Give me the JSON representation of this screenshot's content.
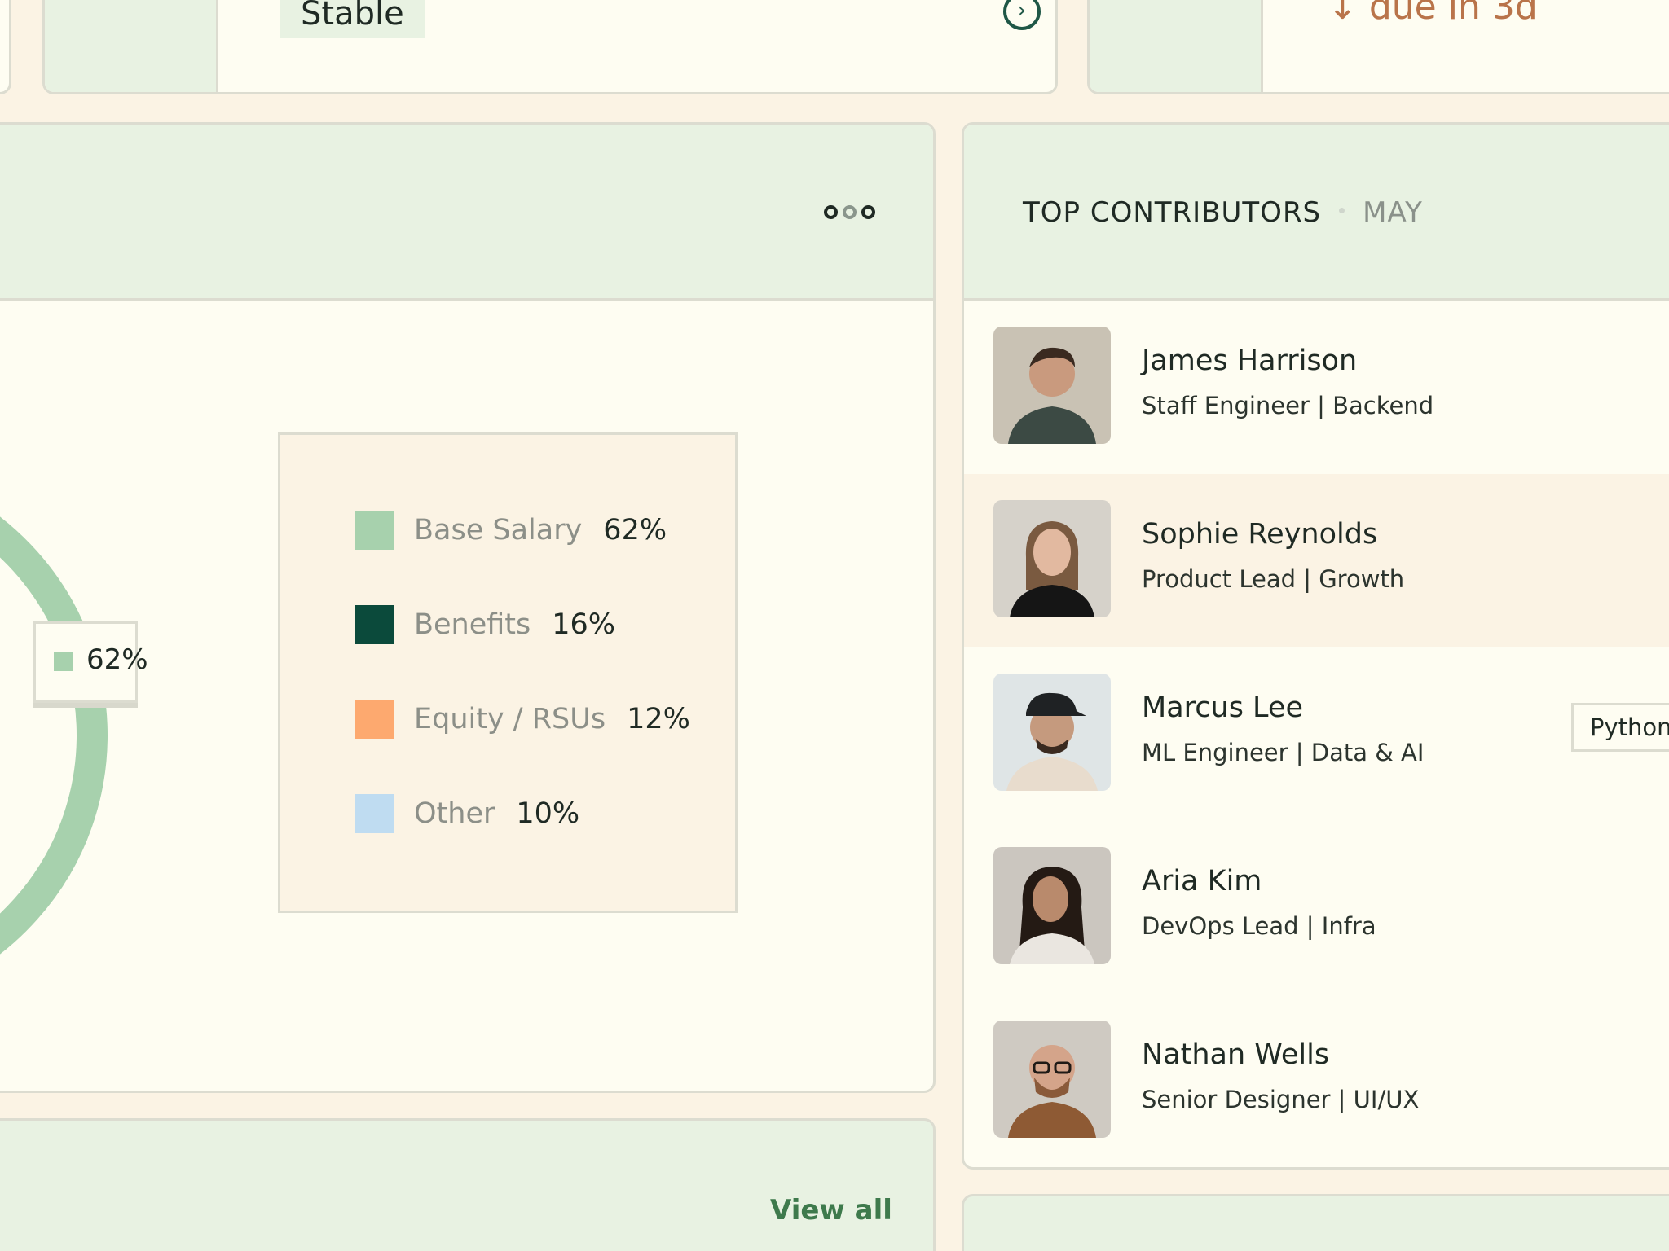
{
  "top_cards": {
    "left": {
      "status_label": "Stable"
    },
    "right": {
      "due_label": "↓ due in 3d"
    }
  },
  "breakdown": {
    "tooltip_value": "62%",
    "legend": [
      {
        "label": "Base Salary",
        "value": "62%",
        "color": "#a7d1ad"
      },
      {
        "label": "Benefits",
        "value": "16%",
        "color": "#0b4a3b"
      },
      {
        "label": "Equity / RSUs",
        "value": "12%",
        "color": "#fda96f"
      },
      {
        "label": "Other",
        "value": "10%",
        "color": "#bfdcf1"
      }
    ]
  },
  "chart_data": {
    "type": "pie",
    "categories": [
      "Base Salary",
      "Benefits",
      "Equity / RSUs",
      "Other"
    ],
    "values": [
      62,
      16,
      12,
      10
    ],
    "title": "",
    "xlabel": "",
    "ylabel": "",
    "legend": "right",
    "colors": [
      "#a7d1ad",
      "#0b4a3b",
      "#fda96f",
      "#bfdcf1"
    ]
  },
  "contributors": {
    "title": "TOP CONTRIBUTORS",
    "month": "MAY",
    "people": [
      {
        "name": "James Harrison",
        "role": "Staff Engineer | Backend"
      },
      {
        "name": "Sophie Reynolds",
        "role": "Product Lead | Growth"
      },
      {
        "name": "Marcus Lee",
        "role": "ML Engineer | Data & AI",
        "tag": "Python"
      },
      {
        "name": "Aria Kim",
        "role": "DevOps Lead | Infra"
      },
      {
        "name": "Nathan Wells",
        "role": "Senior Designer | UI/UX"
      }
    ]
  },
  "bottom": {
    "view_all_label": "View all"
  },
  "colors": {
    "accent_green": "#3e7a4c",
    "card_header": "#e8f2e2",
    "page_bg": "#fbf3e4",
    "due_color": "#b9744a"
  }
}
